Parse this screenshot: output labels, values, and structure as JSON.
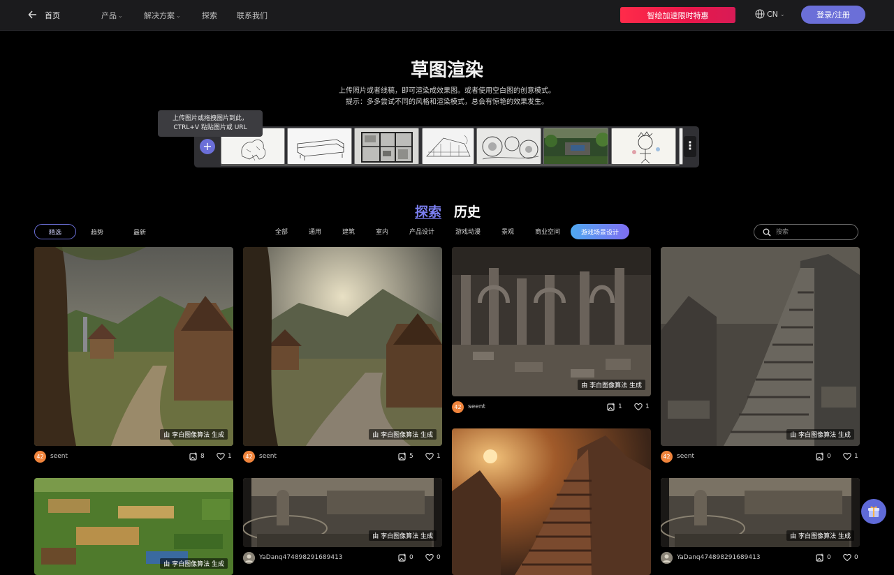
{
  "nav": {
    "home": "首页",
    "items": [
      "产品",
      "解决方案",
      "探索",
      "联系我们"
    ],
    "promo": "智绘加速限时特惠",
    "lang": "CN",
    "login": "登录/注册"
  },
  "hero": {
    "title": "草图渲染",
    "desc1": "上传照片或者线稿，即可渲染成效果图。或者使用空白图的创意模式。",
    "desc2": "提示：多多尝试不同的风格和渲染模式，总会有惊艳的效果发生。",
    "tooltip1": "上传图片或拖拽图片到此，",
    "tooltip2": "CTRL+V 粘贴图片或 URL",
    "upload_symbol": "+"
  },
  "tabs": {
    "explore": "探索",
    "history": "历史"
  },
  "filters": {
    "selected": "精选",
    "trending": "趋势",
    "latest": "最新"
  },
  "categories": [
    "全部",
    "通用",
    "建筑",
    "室内",
    "产品设计",
    "游戏动漫",
    "景观",
    "商业空间"
  ],
  "active_category": "游戏场景设计",
  "search": {
    "placeholder": "搜索"
  },
  "watermark": "由 李白图像算法 生成",
  "cards": [
    {
      "author": "seent",
      "avatar": "42",
      "images": "8",
      "likes": "1"
    },
    {
      "author": "seent",
      "avatar": "42",
      "images": "5",
      "likes": "1"
    },
    {
      "author": "seent",
      "avatar": "42",
      "images": "1",
      "likes": "1"
    },
    {
      "author": "seent",
      "avatar": "42",
      "images": "0",
      "likes": "1"
    },
    {
      "author": "YaDanq474898291689413",
      "images": "0",
      "likes": "0"
    },
    {
      "author": "YaDanq474898291689413",
      "images": "0",
      "likes": "0"
    }
  ],
  "icons": {
    "back": "arrow-left-icon",
    "globe": "globe-icon",
    "search": "search-icon",
    "image": "image-plus-icon",
    "heart": "heart-icon",
    "more": "more-vertical-icon",
    "gift": "gift-icon"
  },
  "colors": {
    "accent": "#6b6fd8",
    "promo": "#ff2b4a",
    "avatar": "#f0843c",
    "background": "#000000"
  }
}
